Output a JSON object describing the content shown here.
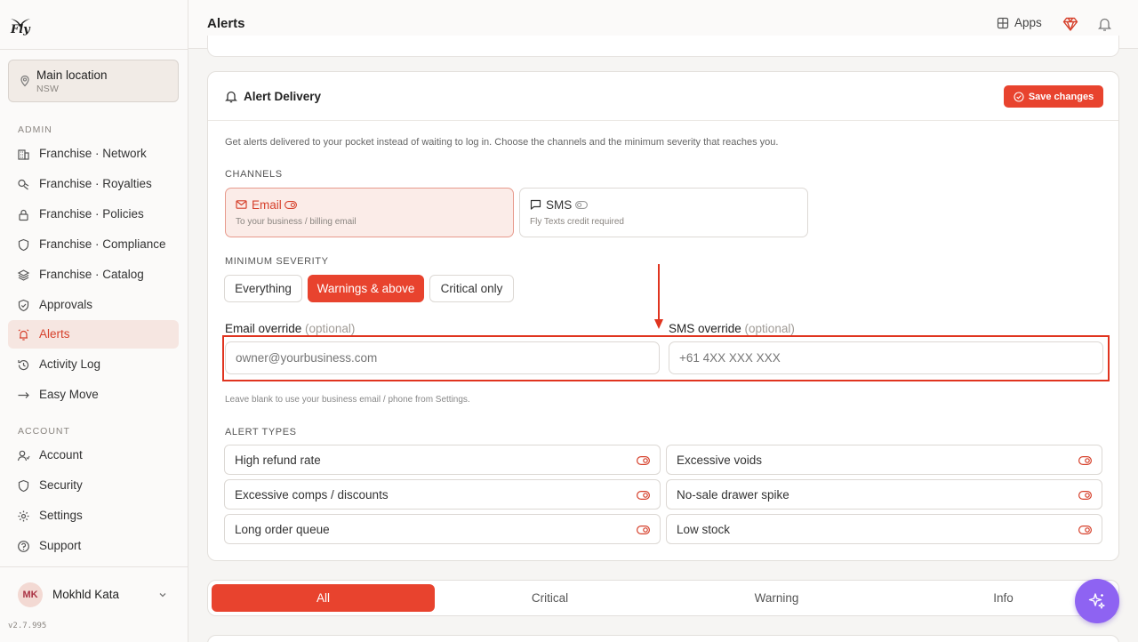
{
  "brand": {
    "logo_text": "Fly"
  },
  "location": {
    "name": "Main location",
    "region": "NSW"
  },
  "sidebar": {
    "admin_label": "ADMIN",
    "admin_items": [
      {
        "label": "Franchise · Network",
        "icon": "buildings-icon"
      },
      {
        "label": "Franchise · Royalties",
        "icon": "coins-icon"
      },
      {
        "label": "Franchise · Policies",
        "icon": "lock-icon"
      },
      {
        "label": "Franchise · Compliance",
        "icon": "shield-icon"
      },
      {
        "label": "Franchise · Catalog",
        "icon": "layers-icon"
      },
      {
        "label": "Approvals",
        "icon": "shield-check-icon"
      },
      {
        "label": "Alerts",
        "icon": "alarm-icon"
      },
      {
        "label": "Activity Log",
        "icon": "history-icon"
      },
      {
        "label": "Easy Move",
        "icon": "arrow-right-icon"
      }
    ],
    "account_label": "ACCOUNT",
    "account_items": [
      {
        "label": "Account",
        "icon": "user-icon"
      },
      {
        "label": "Security",
        "icon": "shield-icon"
      },
      {
        "label": "Settings",
        "icon": "gear-icon"
      },
      {
        "label": "Support",
        "icon": "help-icon"
      }
    ],
    "active": "Alerts"
  },
  "user": {
    "initials": "MK",
    "name": "Mokhld Kata"
  },
  "version": "v2.7.995",
  "header": {
    "title": "Alerts",
    "apps_label": "Apps"
  },
  "card": {
    "title": "Alert Delivery",
    "save_label": "Save changes",
    "description": "Get alerts delivered to your pocket instead of waiting to log in. Choose the channels and the minimum severity that reaches you.",
    "channels_label": "CHANNELS",
    "channels": [
      {
        "name": "Email",
        "sub": "To your business / billing email",
        "enabled": true
      },
      {
        "name": "SMS",
        "sub": "Fly Texts credit required",
        "enabled": false
      }
    ],
    "severity_label": "MINIMUM SEVERITY",
    "severity_options": [
      "Everything",
      "Warnings & above",
      "Critical only"
    ],
    "severity_selected": "Warnings & above",
    "email_override_label": "Email override",
    "sms_override_label": "SMS override",
    "optional_text": "(optional)",
    "email_placeholder": "owner@yourbusiness.com",
    "sms_placeholder": "+61 4XX XXX XXX",
    "override_hint": "Leave blank to use your business email / phone from Settings.",
    "alert_types_label": "ALERT TYPES",
    "alert_types": [
      "High refund rate",
      "Excessive voids",
      "Excessive comps / discounts",
      "No-sale drawer spike",
      "Long order queue",
      "Low stock"
    ]
  },
  "filter_tabs": [
    "All",
    "Critical",
    "Warning",
    "Info"
  ],
  "filter_active": "All",
  "colors": {
    "accent": "#e8432e",
    "fab": "#8e63f2"
  }
}
